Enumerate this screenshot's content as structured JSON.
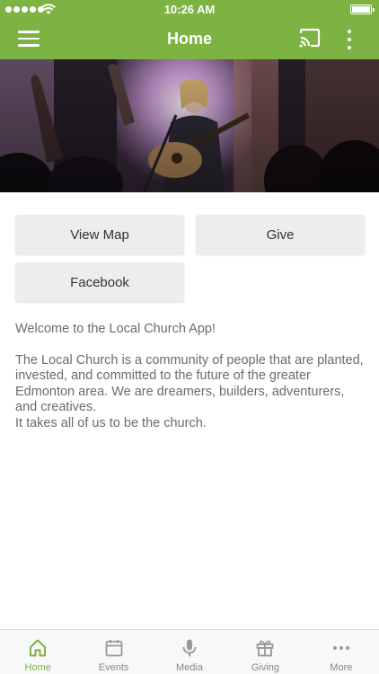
{
  "status_bar": {
    "time": "10:26 AM"
  },
  "header": {
    "title": "Home"
  },
  "buttons": {
    "view_map": "View Map",
    "give": "Give",
    "facebook": "Facebook"
  },
  "content": {
    "welcome": "Welcome to the Local Church App!",
    "about": "The Local Church is a community of people that are planted, invested, and committed to the future of the greater Edmonton area.  We are dreamers, builders, adventurers, and creatives.\nIt takes all of us to be the church."
  },
  "tabs": [
    {
      "label": "Home",
      "icon": "home-icon",
      "active": true
    },
    {
      "label": "Events",
      "icon": "calendar-icon",
      "active": false
    },
    {
      "label": "Media",
      "icon": "microphone-icon",
      "active": false
    },
    {
      "label": "Giving",
      "icon": "gift-icon",
      "active": false
    },
    {
      "label": "More",
      "icon": "ellipsis-icon",
      "active": false
    }
  ],
  "colors": {
    "brand": "#7cb342",
    "button_bg": "#ecedef",
    "body_text": "#6b6b6b",
    "tab_inactive": "#888888"
  }
}
